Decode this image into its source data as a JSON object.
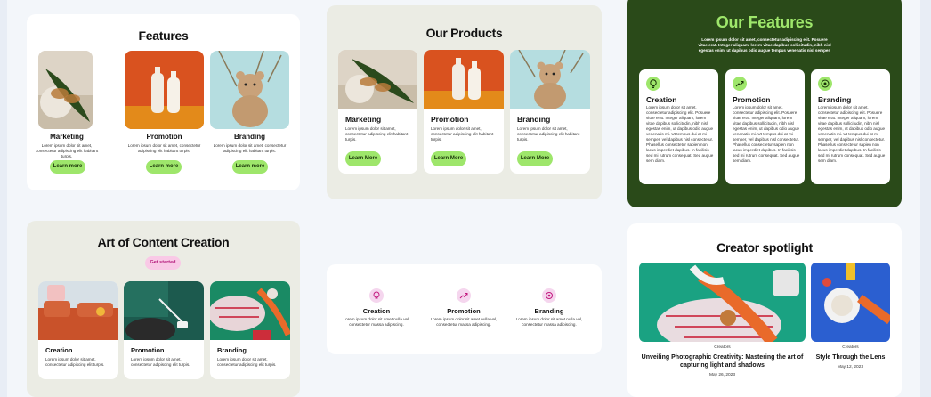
{
  "features": {
    "title": "Features",
    "items": [
      {
        "label": "Marketing",
        "desc": "Lorem ipsum dolor sit amet, consectetur adipiscing elit habitant turpis.",
        "button": "Learn more"
      },
      {
        "label": "Promotion",
        "desc": "Lorem ipsum dolor sit amet, consectetur adipiscing elit habitant turpis.",
        "button": "Learn more"
      },
      {
        "label": "Branding",
        "desc": "Lorem ipsum dolor sit amet, consectetur adipiscing elit habitant turpis.",
        "button": "Learn more"
      }
    ]
  },
  "products": {
    "title": "Our Products",
    "items": [
      {
        "label": "Marketing",
        "desc": "Lorem ipsum dolor sit amet, consectetur adipiscing elit habitant turpis.",
        "button": "Learn More"
      },
      {
        "label": "Promotion",
        "desc": "Lorem ipsum dolor sit amet, consectetur adipiscing elit habitant turpis.",
        "button": "Learn More"
      },
      {
        "label": "Branding",
        "desc": "Lorem ipsum dolor sit amet, consectetur adipiscing elit habitant turpis.",
        "button": "Learn More"
      }
    ]
  },
  "our_features": {
    "title": "Our Features",
    "intro": "Lorem ipsum dolor sit amet, consectetur adipiscing elit. Posuere vitae erat. Integer aliquam, lorem vitae dapibus sollicitudin, nibh nisl egestas enim, ut dapibus odio augue tempus venenatis nisl semper.",
    "items": [
      {
        "label": "Creation",
        "desc": "Lorem ipsum dolor sit amet, consectetur adipiscing elit. Posuere vitae erat. Integer aliquam, lorem vitae dapibus sollicitudin, nibh nisl egestas enim, ut dapibus odio augue venenatis mi. Ut tempus dui at mi semper, vel dapibus nisl consectetur. Phasellus consectetur sapien non lacus imperdiet dapibus. In facilisis sed mi rutrum consequat. Sed augue sem diam."
      },
      {
        "label": "Promotion",
        "desc": "Lorem ipsum dolor sit amet, consectetur adipiscing elit. Posuere vitae erat. Integer aliquam, lorem vitae dapibus sollicitudin, nibh nisl egestas enim, ut dapibus odio augue venenatis mi. Ut tempus dui at mi semper, vel dapibus nisl consectetur. Phasellus consectetur sapien non lacus imperdiet dapibus. In facilisis sed mi rutrum consequat. Sed augue sem diam."
      },
      {
        "label": "Branding",
        "desc": "Lorem ipsum dolor sit amet, consectetur adipiscing elit. Posuere vitae erat. Integer aliquam, lorem vitae dapibus sollicitudin, nibh nisl egestas enim, ut dapibus odio augue venenatis mi. Ut tempus dui at mi semper, vel dapibus nisl consectetur. Phasellus consectetur sapien non lacus imperdiet dapibus. In facilisis sed mi rutrum consequat. Sed augue sem diam."
      }
    ]
  },
  "art": {
    "title": "Art of Content Creation",
    "button": "Get started",
    "items": [
      {
        "label": "Creation",
        "desc": "Lorem ipsum dolor sit amet, consectetur adipiscing elit turpis."
      },
      {
        "label": "Promotion",
        "desc": "Lorem ipsum dolor sit amet, consectetur adipiscing elit turpis."
      },
      {
        "label": "Branding",
        "desc": "Lorem ipsum dolor sit amet, consectetur adipiscing elit turpis."
      }
    ]
  },
  "services": {
    "items": [
      {
        "label": "Creation",
        "desc": "Lorem ipsum dolor sit amet nulla vel, consectetur massa adipiscing.",
        "icon": "bulb-icon"
      },
      {
        "label": "Promotion",
        "desc": "Lorem ipsum dolor sit amet nulla vel, consectetur massa adipiscing.",
        "icon": "trend-up-icon"
      },
      {
        "label": "Branding",
        "desc": "Lorem ipsum dolor sit amet nulla vel, consectetur massa adipiscing.",
        "icon": "brand-icon"
      }
    ]
  },
  "spotlight": {
    "title": "Creator spotlight",
    "posts": [
      {
        "category": "Creators",
        "title": "Unveiling Photographic Creativity: Mastering the art of capturing light and shadows",
        "date": "May 26, 2023"
      },
      {
        "category": "Creators",
        "title": "Style Through the Lens",
        "date": "May 12, 2023"
      }
    ]
  },
  "colors": {
    "accent_green": "#9ee66b",
    "dark_green": "#2a4a19",
    "pink_button": "#f9c9e6",
    "beige": "#ebece4",
    "icon_pink": "#f5d6ee"
  }
}
